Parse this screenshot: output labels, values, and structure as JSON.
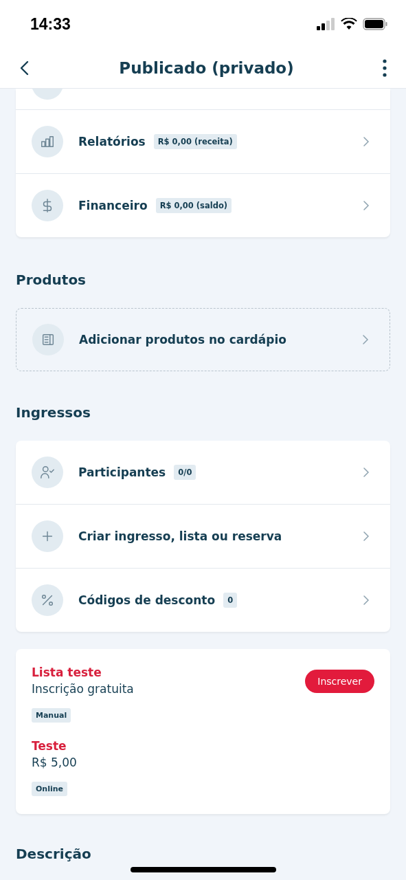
{
  "status_bar": {
    "time": "14:33"
  },
  "header": {
    "title": "Publicado (privado)"
  },
  "top_menu": [
    {
      "label": "Relatórios",
      "badge": "R$ 0,00 (receita)"
    },
    {
      "label": "Financeiro",
      "badge": "R$ 0,00 (saldo)"
    }
  ],
  "produtos": {
    "heading": "Produtos",
    "action": {
      "label": "Adicionar produtos no cardápio"
    }
  },
  "ingressos": {
    "heading": "Ingressos",
    "items": [
      {
        "label": "Participantes",
        "badge": "0/0"
      },
      {
        "label": "Criar ingresso, lista ou reserva"
      },
      {
        "label": "Códigos de desconto",
        "badge": "0"
      }
    ]
  },
  "tickets": [
    {
      "name": "Lista teste",
      "price": "Inscrição gratuita",
      "tag": "Manual",
      "button": "Inscrever"
    },
    {
      "name": "Teste",
      "price": "R$ 5,00",
      "tag": "Online"
    }
  ],
  "descricao": {
    "heading": "Descrição"
  }
}
